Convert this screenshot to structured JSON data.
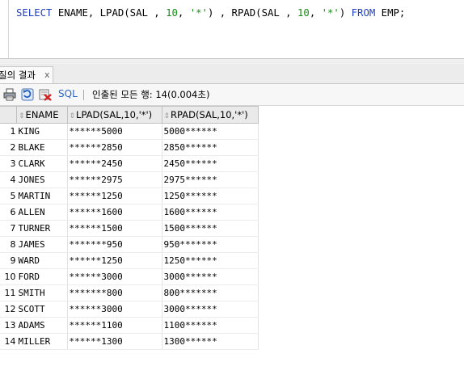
{
  "editor": {
    "sql": [
      {
        "t": "SELECT",
        "c": "kw"
      },
      {
        "t": " ENAME, LPAD(SAL , ",
        "c": "id"
      },
      {
        "t": "10",
        "c": "num"
      },
      {
        "t": ", ",
        "c": "id"
      },
      {
        "t": "'*'",
        "c": "str"
      },
      {
        "t": ") , RPAD(SAL , ",
        "c": "id"
      },
      {
        "t": "10",
        "c": "num"
      },
      {
        "t": ", ",
        "c": "id"
      },
      {
        "t": "'*'",
        "c": "str"
      },
      {
        "t": ") ",
        "c": "id"
      },
      {
        "t": "FROM",
        "c": "kw"
      },
      {
        "t": " EMP;",
        "c": "id"
      }
    ]
  },
  "tab": {
    "title": "질의 결과",
    "close": "x"
  },
  "toolbar": {
    "icons": [
      "print-icon",
      "refresh-icon",
      "cancel-icon"
    ],
    "sql_label": "SQL",
    "status": "인출된 모든 행: 14(0.004초)"
  },
  "grid": {
    "columns": [
      "ENAME",
      "LPAD(SAL,10,'*')",
      "RPAD(SAL,10,'*')"
    ],
    "rows": [
      [
        "1",
        "KING",
        "******5000",
        "5000******"
      ],
      [
        "2",
        "BLAKE",
        "******2850",
        "2850******"
      ],
      [
        "3",
        "CLARK",
        "******2450",
        "2450******"
      ],
      [
        "4",
        "JONES",
        "******2975",
        "2975******"
      ],
      [
        "5",
        "MARTIN",
        "******1250",
        "1250******"
      ],
      [
        "6",
        "ALLEN",
        "******1600",
        "1600******"
      ],
      [
        "7",
        "TURNER",
        "******1500",
        "1500******"
      ],
      [
        "8",
        "JAMES",
        "*******950",
        "950*******"
      ],
      [
        "9",
        "WARD",
        "******1250",
        "1250******"
      ],
      [
        "10",
        "FORD",
        "******3000",
        "3000******"
      ],
      [
        "11",
        "SMITH",
        "*******800",
        "800*******"
      ],
      [
        "12",
        "SCOTT",
        "******3000",
        "3000******"
      ],
      [
        "13",
        "ADAMS",
        "******1100",
        "1100******"
      ],
      [
        "14",
        "MILLER",
        "******1300",
        "1300******"
      ]
    ]
  },
  "colors": {
    "keyword": "#1f3fbf",
    "number": "#1a8a1a",
    "sql_link": "#2a64c8"
  }
}
